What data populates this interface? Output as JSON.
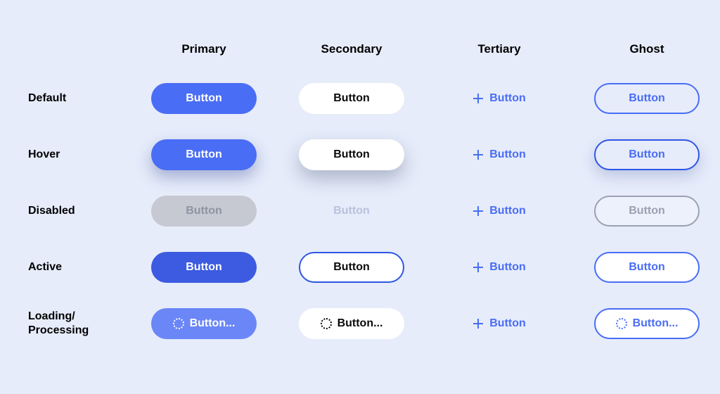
{
  "columns": {
    "primary": "Primary",
    "secondary": "Secondary",
    "tertiary": "Tertiary",
    "ghost": "Ghost"
  },
  "rows": {
    "default": "Default",
    "hover": "Hover",
    "disabled": "Disabled",
    "active": "Active",
    "loading": "Loading/\nProcessing"
  },
  "labels": {
    "button": "Button",
    "button_loading": "Button..."
  },
  "colors": {
    "accent": "#4a6df5",
    "accent_dark": "#3c5be0",
    "accent_light": "#6a86f7",
    "disabled_fill": "#c6c9d1",
    "disabled_text": "#8f94a3",
    "page_bg": "#e6ecfa"
  }
}
